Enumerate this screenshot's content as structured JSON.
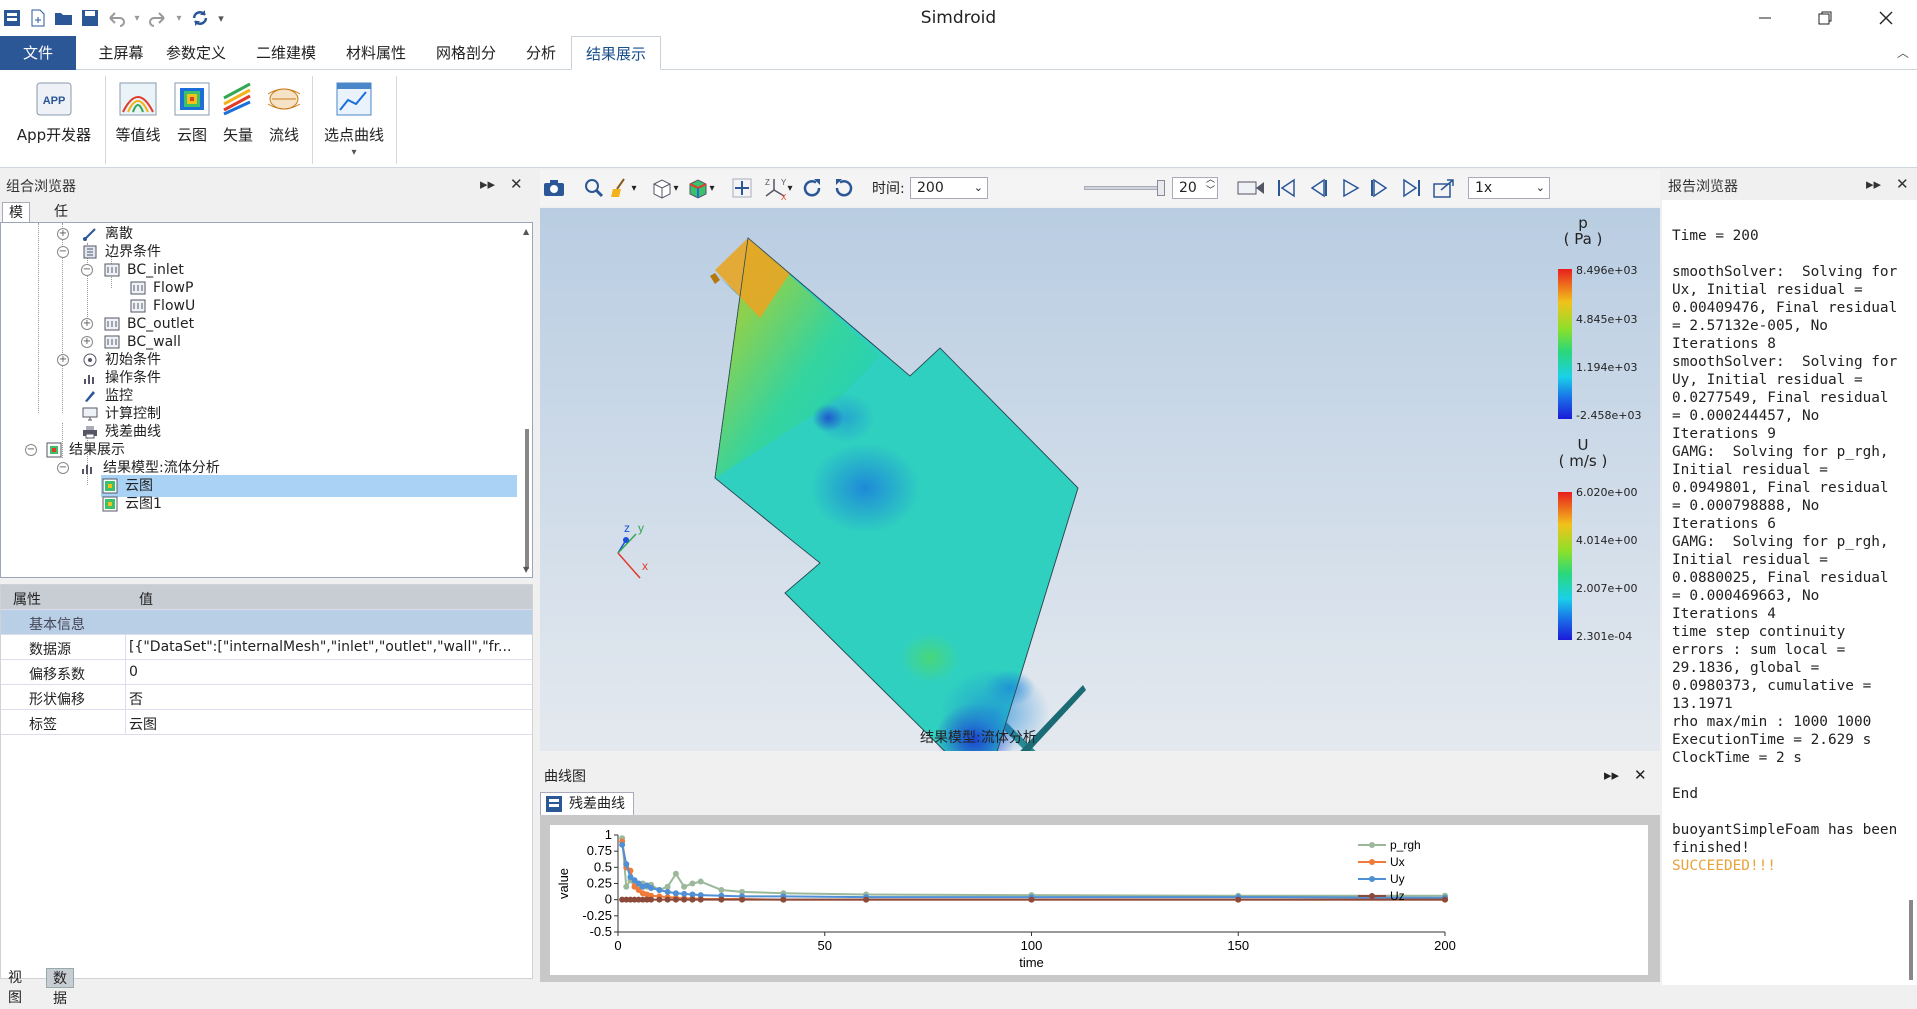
{
  "window": {
    "title": "Simdroid"
  },
  "menu": {
    "file": "文件",
    "tabs": [
      "主屏幕",
      "参数定义",
      "二维建模",
      "材料属性",
      "网格剖分",
      "分析",
      "结果展示"
    ]
  },
  "ribbon": {
    "app_dev": "App开发器",
    "contour": "等值线",
    "cloud": "云图",
    "vector": "矢量",
    "streamline": "流线",
    "point_curve": "选点曲线"
  },
  "left_panel": {
    "title": "组合浏览器",
    "tabs": [
      "模型",
      "任务"
    ],
    "tree": {
      "discrete": "离散",
      "boundary": "边界条件",
      "bc_inlet": "BC_inlet",
      "flowp": "FlowP",
      "flowu": "FlowU",
      "bc_outlet": "BC_outlet",
      "bc_wall": "BC_wall",
      "initial": "初始条件",
      "operating": "操作条件",
      "monitor": "监控",
      "calc_control": "计算控制",
      "residual": "残差曲线",
      "results": "结果展示",
      "result_model": "结果模型:流体分析",
      "cloud": "云图",
      "cloud1": "云图1"
    }
  },
  "properties": {
    "header_key": "属性",
    "header_value": "值",
    "group": "基本信息",
    "rows": [
      {
        "key": "数据源",
        "value": "[{\"DataSet\":[\"internalMesh\",\"inlet\",\"outlet\",\"wall\",\"fr..."
      },
      {
        "key": "偏移系数",
        "value": "0"
      },
      {
        "key": "形状偏移",
        "value": "否"
      },
      {
        "key": "标签",
        "value": "云图"
      }
    ]
  },
  "bottom_tabs": [
    "视图",
    "数据"
  ],
  "viewport_toolbar": {
    "time_label": "时间:",
    "time_value": "200",
    "step_value": "20",
    "speed": "1x"
  },
  "viewport": {
    "caption": "结果模型:流体分析",
    "legend_p": {
      "title": "p",
      "unit": "( Pa )",
      "labels": [
        "8.496e+03",
        "4.845e+03",
        "1.194e+03",
        "-2.458e+03"
      ]
    },
    "legend_u": {
      "title": "U",
      "unit": "( m/s )",
      "labels": [
        "6.020e+00",
        "4.014e+00",
        "2.007e+00",
        "2.301e-04"
      ]
    },
    "axes": {
      "x": "x",
      "y": "y",
      "z": "z"
    }
  },
  "curve_panel": {
    "title": "曲线图",
    "tab": "残差曲线"
  },
  "chart_data": {
    "type": "line",
    "xlabel": "time",
    "ylabel": "value",
    "xlim": [
      0,
      200
    ],
    "ylim": [
      -0.5,
      1
    ],
    "xticks": [
      0,
      50,
      100,
      150,
      200
    ],
    "yticks": [
      1,
      0.75,
      0.5,
      0.25,
      0,
      -0.25,
      -0.5
    ],
    "x": [
      1,
      2,
      3,
      4,
      5,
      6,
      7,
      8,
      10,
      12,
      14,
      16,
      18,
      20,
      25,
      30,
      40,
      60,
      100,
      150,
      200
    ],
    "series": [
      {
        "name": "p_rgh",
        "color": "#9bb89b",
        "values": [
          0.95,
          0.2,
          0.3,
          0.25,
          0.22,
          0.25,
          0.2,
          0.23,
          0.15,
          0.2,
          0.4,
          0.2,
          0.25,
          0.28,
          0.15,
          0.12,
          0.1,
          0.08,
          0.07,
          0.06,
          0.06
        ]
      },
      {
        "name": "Ux",
        "color": "#f07a3a",
        "values": [
          0.9,
          0.5,
          0.45,
          0.2,
          0.15,
          0.1,
          0.08,
          0.06,
          0.05,
          0.04,
          0.03,
          0.02,
          0.02,
          0.01,
          0.01,
          0.01,
          0.0,
          0.0,
          0.0,
          0.0,
          0.0
        ]
      },
      {
        "name": "Uy",
        "color": "#4f8fd6",
        "values": [
          0.85,
          0.55,
          0.35,
          0.3,
          0.25,
          0.2,
          0.22,
          0.18,
          0.15,
          0.12,
          0.1,
          0.09,
          0.08,
          0.07,
          0.06,
          0.05,
          0.05,
          0.04,
          0.04,
          0.04,
          0.03
        ]
      },
      {
        "name": "Uz",
        "color": "#8b4a3a",
        "values": [
          0.0,
          0.0,
          0.0,
          0.0,
          0.0,
          0.0,
          0.0,
          0.0,
          0.0,
          0.0,
          0.0,
          0.0,
          0.0,
          0.0,
          0.0,
          0.0,
          0.0,
          0.0,
          0.0,
          0.0,
          0.0
        ]
      }
    ],
    "legend_position": "right"
  },
  "report": {
    "title": "报告浏览器",
    "top_partial": "",
    "text": "Time = 200\n\nsmoothSolver:  Solving for Ux, Initial residual = 0.00409476, Final residual = 2.57132e-005, No Iterations 8\nsmoothSolver:  Solving for Uy, Initial residual = 0.0277549, Final residual = 0.000244457, No Iterations 9\nGAMG:  Solving for p_rgh, Initial residual = 0.0949801, Final residual = 0.000798888, No Iterations 6\nGAMG:  Solving for p_rgh, Initial residual = 0.0880025, Final residual = 0.000469663, No Iterations 4\ntime step continuity errors : sum local = 29.1836, global = 0.0980373, cumulative = 13.1971\nrho max/min : 1000 1000\nExecutionTime = 2.629 s  ClockTime = 2 s\n\nEnd\n\nbuoyantSimpleFoam has been finished!",
    "status": "SUCCEEDED!!!"
  },
  "colors": {
    "accent": "#2b5797",
    "selection": "#a9d2f4",
    "status_ok": "#e8a33a"
  }
}
